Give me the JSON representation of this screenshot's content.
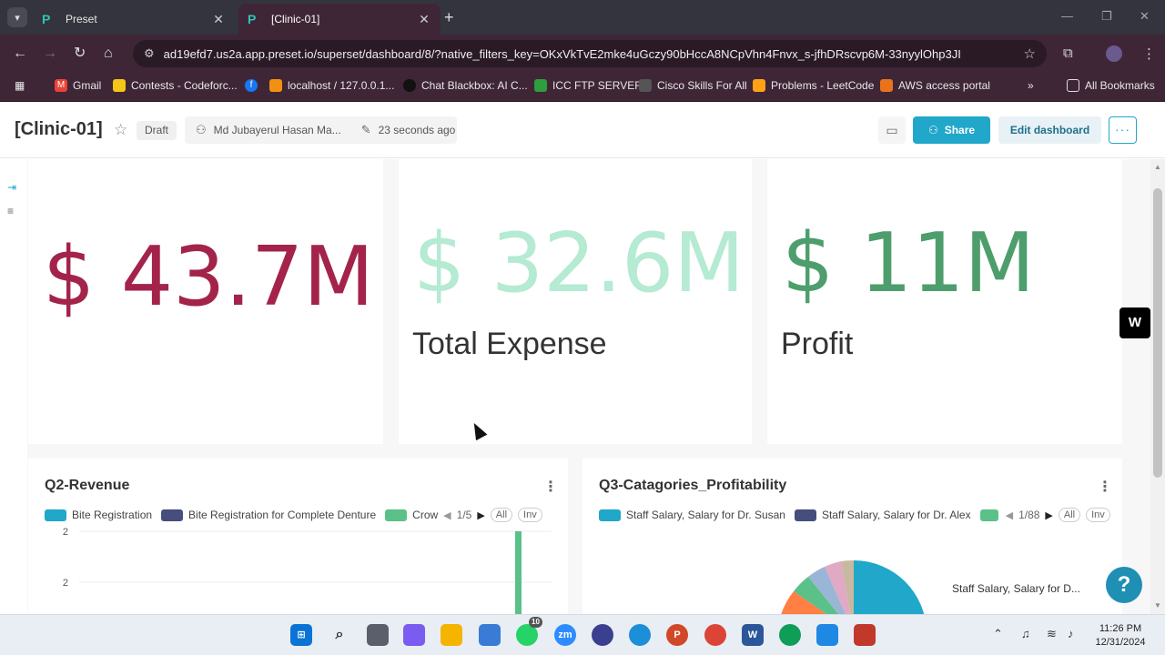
{
  "browser": {
    "tabs": [
      {
        "label": "Preset",
        "active": false,
        "favicon": "preset-logo-icon"
      },
      {
        "label": "[Clinic-01]",
        "active": true,
        "favicon": "preset-logo-icon"
      }
    ],
    "url": "ad19efd7.us2a.app.preset.io/superset/dashboard/8/?native_filters_key=OKxVkTvE2mke4uGczy90bHccA8NCpVhn4Fnvx_s-jfhDRscvp6M-33nyylOhp3JI",
    "bookmarks": [
      {
        "label": "Gmail",
        "icon": "gmail-icon",
        "color": "#ea4335"
      },
      {
        "label": "Contests - Codeforc...",
        "icon": "codeforces-icon",
        "color": "#f5c518"
      },
      {
        "label": "",
        "icon": "facebook-icon",
        "color": "#1877f2"
      },
      {
        "label": "localhost / 127.0.0.1...",
        "icon": "phpmyadmin-icon",
        "color": "#f29111"
      },
      {
        "label": "Chat Blackbox: AI C...",
        "icon": "blackbox-icon",
        "color": "#111111"
      },
      {
        "label": "ICC FTP SERVER",
        "icon": "icc-icon",
        "color": "#2e9e3e"
      },
      {
        "label": "Cisco Skills For All",
        "icon": "cisco-icon",
        "color": "#555555"
      },
      {
        "label": "Problems - LeetCode",
        "icon": "leetcode-icon",
        "color": "#ffa116"
      },
      {
        "label": "AWS access portal",
        "icon": "aws-icon",
        "color": "#e8731a"
      }
    ],
    "all_bookmarks": "All Bookmarks"
  },
  "dashboard": {
    "title": "[Clinic-01]",
    "status": "Draft",
    "owner": "Md Jubayerul Hasan Ma...",
    "modified": "23 seconds ago",
    "share_label": "Share",
    "edit_label": "Edit dashboard",
    "more_label": "···"
  },
  "big_numbers": [
    {
      "value": "$ 43.7M",
      "subheader": "",
      "color": "#a3234b"
    },
    {
      "value": "$ 32.6M",
      "subheader": "Total Expense",
      "color": "#b5ead3"
    },
    {
      "value": "$ 11M",
      "subheader": "Profit",
      "color": "#4d9e6c"
    }
  ],
  "charts": [
    {
      "title": "Q2-Revenue",
      "legend": [
        {
          "label": "Bite Registration",
          "color": "#20a7c9"
        },
        {
          "label": "Bite Registration for Complete Denture",
          "color": "#454e7c"
        },
        {
          "label": "Crow",
          "color": "#5ac189"
        }
      ],
      "pager": "1/5",
      "all_label": "All",
      "inv_label": "Inv",
      "y_ticks": [
        "2",
        "2"
      ]
    },
    {
      "title": "Q3-Catagories_Profitability",
      "legend": [
        {
          "label": "Staff Salary, Salary for Dr. Susan",
          "color": "#20a7c9"
        },
        {
          "label": "Staff Salary, Salary for Dr. Alex",
          "color": "#454e7c"
        },
        {
          "label": "",
          "color": "#5ac189"
        }
      ],
      "pager": "1/88",
      "all_label": "All",
      "inv_label": "Inv",
      "pie_label": "Staff Salary, Salary for D..."
    }
  ],
  "taskbar": {
    "time": "11:26 PM",
    "date": "12/31/2024",
    "whatsapp_badge": "10"
  }
}
